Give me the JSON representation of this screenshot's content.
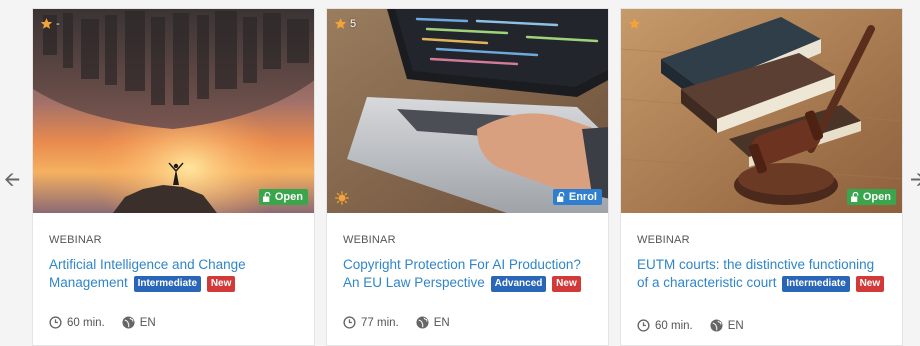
{
  "nav": {
    "prev_icon": "arrow-left-icon",
    "next_icon": "arrow-right-icon"
  },
  "colors": {
    "link": "#2f86c9",
    "level_badge": "#2a66b8",
    "new_badge": "#d23a3a",
    "open_badge": "#3aa64b",
    "enrol_badge": "#2f7fd0",
    "star": "#f2a33a"
  },
  "cards": [
    {
      "rating": "-",
      "image": "person on cliff under inverted city at sunset",
      "access": "Open",
      "type": "WEBINAR",
      "title": "Artificial Intelligence and Change Management",
      "level": "Intermediate",
      "new": "New",
      "duration": "60 min.",
      "language": "EN"
    },
    {
      "rating": "5",
      "image": "hands typing on laptop with code",
      "access": "Enrol",
      "type": "WEBINAR",
      "title": "Copyright Protection For AI Production? An EU Law Perspective",
      "level": "Advanced",
      "new": "New",
      "duration": "77 min.",
      "language": "EN"
    },
    {
      "rating": "",
      "image": "judge gavel and law books on wooden desk",
      "access": "Open",
      "type": "WEBINAR",
      "title": "EUTM courts: the distinctive functioning of a characteristic court",
      "level": "Intermediate",
      "new": "New",
      "duration": "60 min.",
      "language": "EN"
    }
  ]
}
